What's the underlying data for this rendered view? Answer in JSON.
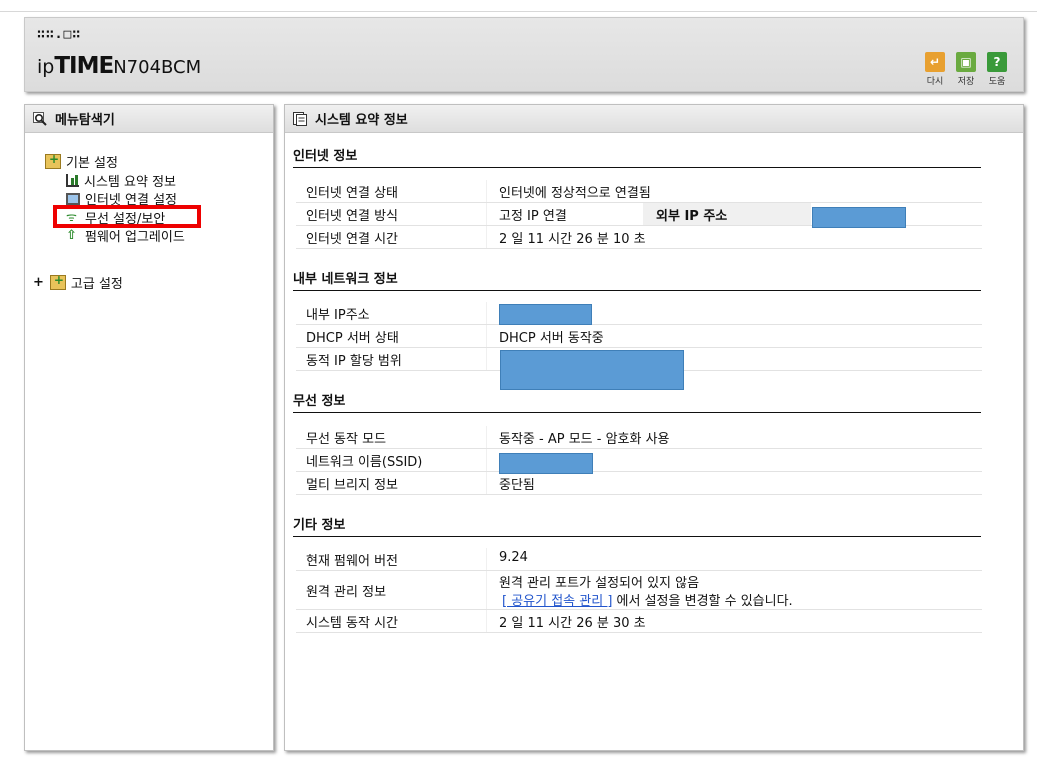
{
  "header": {
    "logo_dots": "∷∷.□∷",
    "logo_ip": "ip",
    "logo_time": "TIME",
    "model": "N704BCM",
    "buttons": [
      {
        "label": "다시",
        "icon": "refresh-icon",
        "color": "#e8a030",
        "glyph": "↵"
      },
      {
        "label": "저장",
        "icon": "save-icon",
        "color": "#6aaa40",
        "glyph": "▣"
      },
      {
        "label": "도움",
        "icon": "help-icon",
        "color": "#3a9a3a",
        "glyph": "?"
      }
    ]
  },
  "sidebar": {
    "title": "메뉴탐색기",
    "basic_label": "기본 설정",
    "items": [
      {
        "label": "시스템 요약 정보",
        "icon": "chart-icon"
      },
      {
        "label": "인터넷 연결 설정",
        "icon": "monitor-icon"
      },
      {
        "label": "무선 설정/보안",
        "icon": "wireless-icon"
      },
      {
        "label": "펌웨어 업그레이드",
        "icon": "upgrade-icon"
      }
    ],
    "advanced_expander": "+",
    "advanced_label": "고급 설정"
  },
  "main": {
    "title": "시스템 요약 정보",
    "internet": {
      "title": "인터넷 정보",
      "status_label": "인터넷 연결 상태",
      "status_value": "인터넷에 정상적으로 연결됨",
      "method_label": "인터넷 연결 방식",
      "method_value": "고정 IP 연결",
      "external_ip_label": "외부 IP 주소",
      "time_label": "인터넷 연결 시간",
      "time_value": "2 일 11 시간 26 분 10 초"
    },
    "lan": {
      "title": "내부 네트워크 정보",
      "ip_label": "내부 IP주소",
      "dhcp_label": "DHCP 서버 상태",
      "dhcp_value": "DHCP 서버 동작중",
      "range_label": "동적 IP 할당 범위"
    },
    "wireless": {
      "title": "무선 정보",
      "mode_label": "무선 동작 모드",
      "mode_value": "동작중 - AP 모드 - 암호화 사용",
      "ssid_label": "네트워크 이름(SSID)",
      "bridge_label": "멀티 브리지 정보",
      "bridge_value": "중단됨"
    },
    "other": {
      "title": "기타 정보",
      "fw_label": "현재 펌웨어 버전",
      "fw_value": "9.24",
      "remote_label": "원격 관리 정보",
      "remote_line1": "원격 관리 포트가 설정되어 있지 않음",
      "remote_link": "[ 공유기 접속 관리 ]",
      "remote_line2": " 에서 설정을 변경할 수 있습니다.",
      "uptime_label": "시스템 동작 시간",
      "uptime_value": "2 일 11 시간 26 분 30 초"
    }
  },
  "colors": {
    "redaction": "#5b9bd5",
    "highlight_box": "#ee0000",
    "link": "#2255cc"
  }
}
